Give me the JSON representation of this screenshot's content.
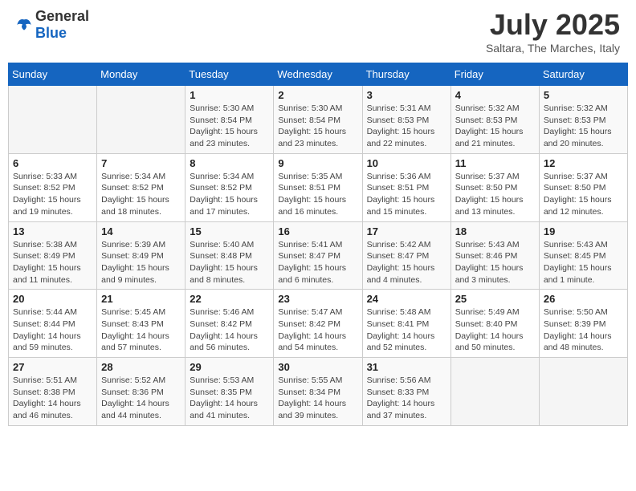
{
  "header": {
    "logo_general": "General",
    "logo_blue": "Blue",
    "month_year": "July 2025",
    "location": "Saltara, The Marches, Italy"
  },
  "weekdays": [
    "Sunday",
    "Monday",
    "Tuesday",
    "Wednesday",
    "Thursday",
    "Friday",
    "Saturday"
  ],
  "weeks": [
    [
      {
        "day": "",
        "info": ""
      },
      {
        "day": "",
        "info": ""
      },
      {
        "day": "1",
        "info": "Sunrise: 5:30 AM\nSunset: 8:54 PM\nDaylight: 15 hours and 23 minutes."
      },
      {
        "day": "2",
        "info": "Sunrise: 5:30 AM\nSunset: 8:54 PM\nDaylight: 15 hours and 23 minutes."
      },
      {
        "day": "3",
        "info": "Sunrise: 5:31 AM\nSunset: 8:53 PM\nDaylight: 15 hours and 22 minutes."
      },
      {
        "day": "4",
        "info": "Sunrise: 5:32 AM\nSunset: 8:53 PM\nDaylight: 15 hours and 21 minutes."
      },
      {
        "day": "5",
        "info": "Sunrise: 5:32 AM\nSunset: 8:53 PM\nDaylight: 15 hours and 20 minutes."
      }
    ],
    [
      {
        "day": "6",
        "info": "Sunrise: 5:33 AM\nSunset: 8:52 PM\nDaylight: 15 hours and 19 minutes."
      },
      {
        "day": "7",
        "info": "Sunrise: 5:34 AM\nSunset: 8:52 PM\nDaylight: 15 hours and 18 minutes."
      },
      {
        "day": "8",
        "info": "Sunrise: 5:34 AM\nSunset: 8:52 PM\nDaylight: 15 hours and 17 minutes."
      },
      {
        "day": "9",
        "info": "Sunrise: 5:35 AM\nSunset: 8:51 PM\nDaylight: 15 hours and 16 minutes."
      },
      {
        "day": "10",
        "info": "Sunrise: 5:36 AM\nSunset: 8:51 PM\nDaylight: 15 hours and 15 minutes."
      },
      {
        "day": "11",
        "info": "Sunrise: 5:37 AM\nSunset: 8:50 PM\nDaylight: 15 hours and 13 minutes."
      },
      {
        "day": "12",
        "info": "Sunrise: 5:37 AM\nSunset: 8:50 PM\nDaylight: 15 hours and 12 minutes."
      }
    ],
    [
      {
        "day": "13",
        "info": "Sunrise: 5:38 AM\nSunset: 8:49 PM\nDaylight: 15 hours and 11 minutes."
      },
      {
        "day": "14",
        "info": "Sunrise: 5:39 AM\nSunset: 8:49 PM\nDaylight: 15 hours and 9 minutes."
      },
      {
        "day": "15",
        "info": "Sunrise: 5:40 AM\nSunset: 8:48 PM\nDaylight: 15 hours and 8 minutes."
      },
      {
        "day": "16",
        "info": "Sunrise: 5:41 AM\nSunset: 8:47 PM\nDaylight: 15 hours and 6 minutes."
      },
      {
        "day": "17",
        "info": "Sunrise: 5:42 AM\nSunset: 8:47 PM\nDaylight: 15 hours and 4 minutes."
      },
      {
        "day": "18",
        "info": "Sunrise: 5:43 AM\nSunset: 8:46 PM\nDaylight: 15 hours and 3 minutes."
      },
      {
        "day": "19",
        "info": "Sunrise: 5:43 AM\nSunset: 8:45 PM\nDaylight: 15 hours and 1 minute."
      }
    ],
    [
      {
        "day": "20",
        "info": "Sunrise: 5:44 AM\nSunset: 8:44 PM\nDaylight: 14 hours and 59 minutes."
      },
      {
        "day": "21",
        "info": "Sunrise: 5:45 AM\nSunset: 8:43 PM\nDaylight: 14 hours and 57 minutes."
      },
      {
        "day": "22",
        "info": "Sunrise: 5:46 AM\nSunset: 8:42 PM\nDaylight: 14 hours and 56 minutes."
      },
      {
        "day": "23",
        "info": "Sunrise: 5:47 AM\nSunset: 8:42 PM\nDaylight: 14 hours and 54 minutes."
      },
      {
        "day": "24",
        "info": "Sunrise: 5:48 AM\nSunset: 8:41 PM\nDaylight: 14 hours and 52 minutes."
      },
      {
        "day": "25",
        "info": "Sunrise: 5:49 AM\nSunset: 8:40 PM\nDaylight: 14 hours and 50 minutes."
      },
      {
        "day": "26",
        "info": "Sunrise: 5:50 AM\nSunset: 8:39 PM\nDaylight: 14 hours and 48 minutes."
      }
    ],
    [
      {
        "day": "27",
        "info": "Sunrise: 5:51 AM\nSunset: 8:38 PM\nDaylight: 14 hours and 46 minutes."
      },
      {
        "day": "28",
        "info": "Sunrise: 5:52 AM\nSunset: 8:36 PM\nDaylight: 14 hours and 44 minutes."
      },
      {
        "day": "29",
        "info": "Sunrise: 5:53 AM\nSunset: 8:35 PM\nDaylight: 14 hours and 41 minutes."
      },
      {
        "day": "30",
        "info": "Sunrise: 5:55 AM\nSunset: 8:34 PM\nDaylight: 14 hours and 39 minutes."
      },
      {
        "day": "31",
        "info": "Sunrise: 5:56 AM\nSunset: 8:33 PM\nDaylight: 14 hours and 37 minutes."
      },
      {
        "day": "",
        "info": ""
      },
      {
        "day": "",
        "info": ""
      }
    ]
  ]
}
